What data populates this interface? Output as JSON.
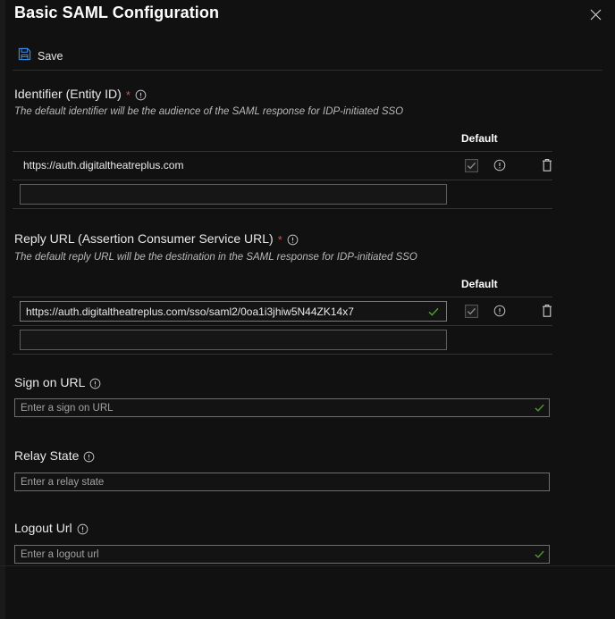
{
  "header": {
    "title": "Basic SAML Configuration",
    "close_icon": "close-icon"
  },
  "command_bar": {
    "save_label": "Save",
    "save_icon": "save-floppy-icon"
  },
  "sections": {
    "identifier": {
      "label": "Identifier (Entity ID)",
      "required_marker": "*",
      "info_icon": "info-circle-icon",
      "description": "The default identifier will be the audience of the SAML response for IDP-initiated SSO",
      "column_header_default": "Default",
      "rows": [
        {
          "value": "https://auth.digitaltheatreplus.com",
          "is_input": false,
          "valid_check": false,
          "default_checked": true,
          "default_disabled": true,
          "info_icon": "info-circle-icon",
          "delete_icon": "trash-icon"
        }
      ],
      "new_row_placeholder": ""
    },
    "reply_url": {
      "label": "Reply URL (Assertion Consumer Service URL)",
      "required_marker": "*",
      "info_icon": "info-circle-icon",
      "description": "The default reply URL will be the destination in the SAML response for IDP-initiated SSO",
      "column_header_default": "Default",
      "rows": [
        {
          "value": "https://auth.digitaltheatreplus.com/sso/saml2/0oa1i3jhiw5N44ZK14x7",
          "is_input": true,
          "valid_check": true,
          "default_checked": true,
          "default_disabled": true,
          "info_icon": "info-circle-icon",
          "delete_icon": "trash-icon"
        }
      ],
      "new_row_placeholder": ""
    },
    "sign_on_url": {
      "label": "Sign on URL",
      "info_icon": "info-circle-icon",
      "placeholder": "Enter a sign on URL",
      "value": "",
      "valid_check": true
    },
    "relay_state": {
      "label": "Relay State",
      "info_icon": "info-circle-icon",
      "placeholder": "Enter a relay state",
      "value": "",
      "valid_check": false
    },
    "logout_url": {
      "label": "Logout Url",
      "info_icon": "info-circle-icon",
      "placeholder": "Enter a logout url",
      "value": "",
      "valid_check": true
    }
  },
  "colors": {
    "background": "#111111",
    "accent_blue": "#3b8ce8",
    "required_red": "#e04a4a",
    "valid_green": "#4f9b2e",
    "text_primary": "#e8e8e8",
    "text_muted": "#b9b9b9"
  }
}
